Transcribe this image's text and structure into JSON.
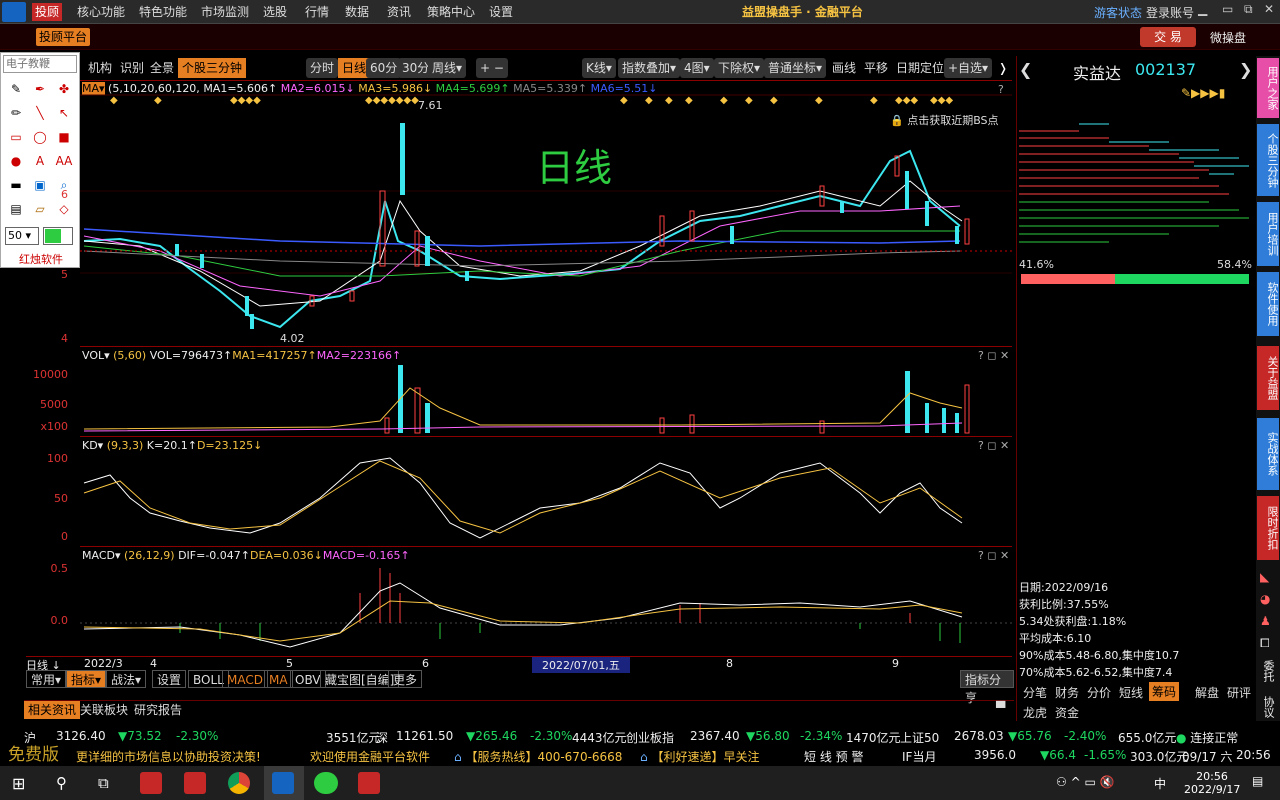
{
  "menu": {
    "items": [
      "投顾",
      "核心功能",
      "特色功能",
      "市场监测",
      "选股",
      "行情",
      "数据",
      "资讯",
      "策略中心",
      "设置"
    ],
    "app_title": "益盟操盘手 · 金融平台",
    "guest_status": "游客状态",
    "login": "登录账号"
  },
  "toolbar": {
    "advisor_platform": "投顾平台",
    "trade": "交 易",
    "mini": "微操盘"
  },
  "draw": {
    "search_placeholder": "电子教鞭",
    "size": "50",
    "vendor": "红烛软件"
  },
  "chart_toolbar": {
    "left": [
      "机构",
      "识别",
      "全景"
    ],
    "mode": "个股三分钟",
    "periods": [
      "分时",
      "日线",
      "60分",
      "30分",
      "周线▾"
    ],
    "plusminus": "+ −",
    "kline": "K线▾",
    "overlay": "指数叠加▾",
    "panes": "4图▾",
    "adjust": "下除权▾",
    "coord": "普通坐标▾",
    "draw": "画线",
    "pan": "平移",
    "locate": "日期定位",
    "fav": "+自选▾"
  },
  "ma_line": {
    "prefix": "MA▾",
    "params": "(5,10,20,60,120,",
    "ma1": "MA1=5.606↑",
    "ma2": "MA2=6.015↓",
    "ma3": "MA3=5.986↓",
    "ma4": "MA4=5.699↑",
    "ma5": "MA5=5.339↑",
    "ma6": "MA6=5.51↓"
  },
  "main_chart": {
    "watermark": "日线",
    "high_label": "7.61",
    "low_label": "4.02",
    "bs_hint": "点击获取近期BS点",
    "y_ticks": [
      "6",
      "5",
      "4"
    ]
  },
  "vol": {
    "label": "VOL▾",
    "params": "(5,60)",
    "vol": "VOL=796473↑",
    "ma1": "MA1=417257↑",
    "ma2": "MA2=223166↑",
    "y_ticks": [
      "10000",
      "5000",
      "x100"
    ]
  },
  "kd": {
    "label": "KD▾",
    "params": "(9,3,3)",
    "k": "K=20.1↑",
    "d": "D=23.125↓",
    "y_ticks": [
      "100",
      "50",
      "0"
    ]
  },
  "macd": {
    "label": "MACD▾",
    "params": "(26,12,9)",
    "dif": "DIF=-0.047↑",
    "dea": "DEA=0.036↓",
    "macd": "MACD=-0.165↑",
    "y_ticks": [
      "0.5",
      "0.0"
    ]
  },
  "xaxis": {
    "left": "日线 ↓",
    "labels": [
      "2022/3",
      "4",
      "5",
      "6",
      "8",
      "9"
    ],
    "cursor": "2022/07/01,五"
  },
  "bottom_tabs": {
    "items": [
      "常用▾",
      "指标▾",
      "战法▾",
      "设置",
      "BOLL",
      "MACD",
      "MA",
      "OBV",
      "藏宝图[自编]",
      "更多"
    ],
    "share": "指标分享"
  },
  "info_tabs": {
    "items": [
      "相关资讯",
      "关联板块",
      "研究报告"
    ]
  },
  "stock": {
    "name": "实益达",
    "code": "002137"
  },
  "chip": {
    "left_pct": "41.6%",
    "right_pct": "58.4%",
    "date": "日期:2022/09/16",
    "profit_ratio": "获利比例:37.55%",
    "profit_at": "5.34处获利盘:1.18%",
    "avg_cost": "平均成本:6.10",
    "c90": "90%成本5.48-6.80,集中度10.7",
    "c70": "70%成本5.62-6.52,集中度7.4"
  },
  "right_tabs": {
    "row1": [
      "分笔",
      "财务",
      "分价",
      "短线",
      "筹码",
      "解盘",
      "研评"
    ],
    "row2": [
      "龙虎",
      "资金"
    ]
  },
  "side_tabs": [
    "用户之家",
    "个股三分钟",
    "用户培训",
    "软件使用",
    "关于益盟",
    "实战体系",
    "限时折扣"
  ],
  "side_icons": [
    "退出"
  ],
  "ticker1": {
    "items": [
      [
        "沪",
        "white"
      ],
      [
        "3126.40",
        "white"
      ],
      [
        "▼73.52",
        "green"
      ],
      [
        "-2.30%",
        "green"
      ],
      [
        "3551亿元",
        "white"
      ],
      [
        "深",
        "white"
      ],
      [
        "11261.50",
        "white"
      ],
      [
        "▼265.46",
        "green"
      ],
      [
        "-2.30%",
        "green"
      ],
      [
        "4443亿元",
        "white"
      ],
      [
        "创业板指",
        "white"
      ],
      [
        "2367.40",
        "white"
      ],
      [
        "▼56.80",
        "green"
      ],
      [
        "-2.34%",
        "green"
      ],
      [
        "1470亿元",
        "white"
      ],
      [
        "上证50",
        "white"
      ],
      [
        "2678.03",
        "white"
      ],
      [
        "▼65.76",
        "green"
      ],
      [
        "-2.40%",
        "green"
      ],
      [
        "655.0亿元",
        "white"
      ]
    ],
    "status": "连接正常"
  },
  "ticker2": {
    "free": "免费版",
    "items": [
      "更详细的市场信息以协助投资决策!",
      "欢迎使用金融平台软件",
      "【服务热线】400-670-6668",
      "【利好速递】早关注",
      "短 线 预 警",
      "IF当月"
    ],
    "if_val": "3956.0",
    "if_chg": "▼66.4",
    "if_pct": "-1.65%",
    "if_amt": "303.0亿元",
    "date": "09/17 六",
    "time": "20:56"
  },
  "taskbar": {
    "time": "20:56",
    "date": "2022/9/17",
    "ime": "中"
  },
  "colors": {
    "up": "#ff4040",
    "down": "#3ce7f0",
    "accent": "#e67e22",
    "border": "#8b0000"
  }
}
